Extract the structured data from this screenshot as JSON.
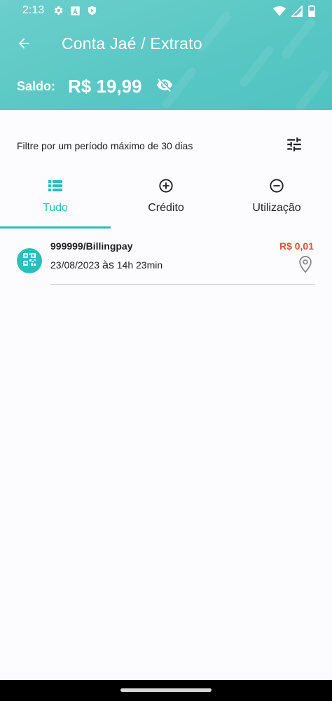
{
  "status_bar": {
    "time": "2:13",
    "left_icons": [
      "gear-icon",
      "a-box-icon",
      "shield-play-icon"
    ],
    "right_icons": [
      "wifi-icon",
      "signal-icon",
      "battery-icon"
    ]
  },
  "header": {
    "title": "Conta Jaé / Extrato",
    "balance_label": "Saldo:",
    "balance_value": "R$ 19,99",
    "background_color": "#5ccac7"
  },
  "filter": {
    "hint": "Filtre por um período máximo de 30 dias"
  },
  "tabs": [
    {
      "label": "Tudo",
      "icon": "list-icon",
      "active": true
    },
    {
      "label": "Crédito",
      "icon": "plus-circle-icon",
      "active": false
    },
    {
      "label": "Utilização",
      "icon": "minus-circle-icon",
      "active": false
    }
  ],
  "transactions": [
    {
      "name": "999999/Billingpay",
      "amount": "R$ 0,01",
      "date": "23/08/2023",
      "separator": "às",
      "time": "14h 23min",
      "icon": "qr-code-icon"
    }
  ],
  "colors": {
    "accent": "#2bbfbc",
    "amount_negative": "#e0503f"
  }
}
